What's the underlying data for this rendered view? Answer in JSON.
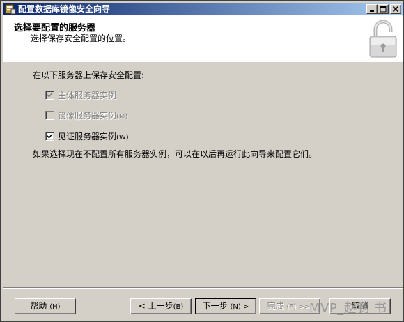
{
  "window": {
    "title": "配置数据库镜像安全向导",
    "icon": "database-app-icon",
    "controls": [
      "minimize-icon",
      "maximize-icon",
      "close-icon"
    ]
  },
  "header": {
    "title": "选择要配置的服务器",
    "subtitle": "选择保存安全配置的位置。",
    "icon": "lock-icon"
  },
  "body": {
    "prompt": "在以下服务器上保存安全配置:",
    "options": [
      {
        "label": "主体服务器实例",
        "shortcut": "",
        "checked": true,
        "enabled": false
      },
      {
        "label": "镜像服务器实例",
        "shortcut": "(M)",
        "checked": false,
        "enabled": false
      },
      {
        "label": "见证服务器实例",
        "shortcut": "(W)",
        "checked": true,
        "enabled": true
      }
    ],
    "note": "如果选择现在不配置所有服务器实例，可以在以后再运行此向导来配置它们。"
  },
  "buttons": {
    "help": {
      "label": "帮助",
      "shortcut": "(H)"
    },
    "back": {
      "label": "< 上一步",
      "shortcut": "(B)"
    },
    "next": {
      "label": "下一步",
      "shortcut": "(N) >"
    },
    "finish": {
      "label": "完成",
      "shortcut": "(F) >>|"
    },
    "cancel": {
      "label": "取消",
      "shortcut": ""
    }
  },
  "watermark": "MVP_赵钊 书",
  "colors": {
    "titlebar_start": "#0a246a",
    "titlebar_end": "#a6caf0",
    "face": "#d4d0c8",
    "disabled_text": "#808080"
  }
}
